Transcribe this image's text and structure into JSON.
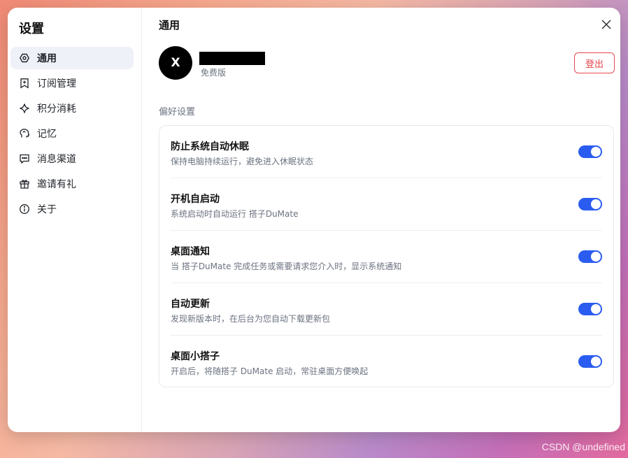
{
  "sidebar": {
    "title": "设置",
    "items": [
      {
        "label": "通用",
        "icon": "hexagon-settings-icon",
        "active": true
      },
      {
        "label": "订阅管理",
        "icon": "bookmark-plus-icon"
      },
      {
        "label": "积分消耗",
        "icon": "sparkle-icon"
      },
      {
        "label": "记忆",
        "icon": "brain-icon"
      },
      {
        "label": "消息渠道",
        "icon": "message-dots-icon"
      },
      {
        "label": "邀请有礼",
        "icon": "gift-icon"
      },
      {
        "label": "关于",
        "icon": "info-icon"
      }
    ]
  },
  "main": {
    "title": "通用",
    "profile": {
      "avatar_letter": "X",
      "plan": "免费版"
    },
    "logout_label": "登出",
    "section_label": "偏好设置",
    "settings": [
      {
        "title": "防止系统自动休眠",
        "desc": "保持电脑持续运行，避免进入休眠状态",
        "enabled": true
      },
      {
        "title": "开机自启动",
        "desc": "系统启动时自动运行 搭子DuMate",
        "enabled": true
      },
      {
        "title": "桌面通知",
        "desc": "当 搭子DuMate 完成任务或需要请求您介入时，显示系统通知",
        "enabled": true
      },
      {
        "title": "自动更新",
        "desc": "发现新版本时，在后台为您自动下载更新包",
        "enabled": true
      },
      {
        "title": "桌面小搭子",
        "desc": "开启后，将随搭子 DuMate 启动，常驻桌面方便唤起",
        "enabled": true
      }
    ]
  },
  "colors": {
    "accent": "#2b5cf0",
    "danger": "#e5484d",
    "active_bg": "#eef1f7"
  },
  "watermark": "CSDN @undefined"
}
